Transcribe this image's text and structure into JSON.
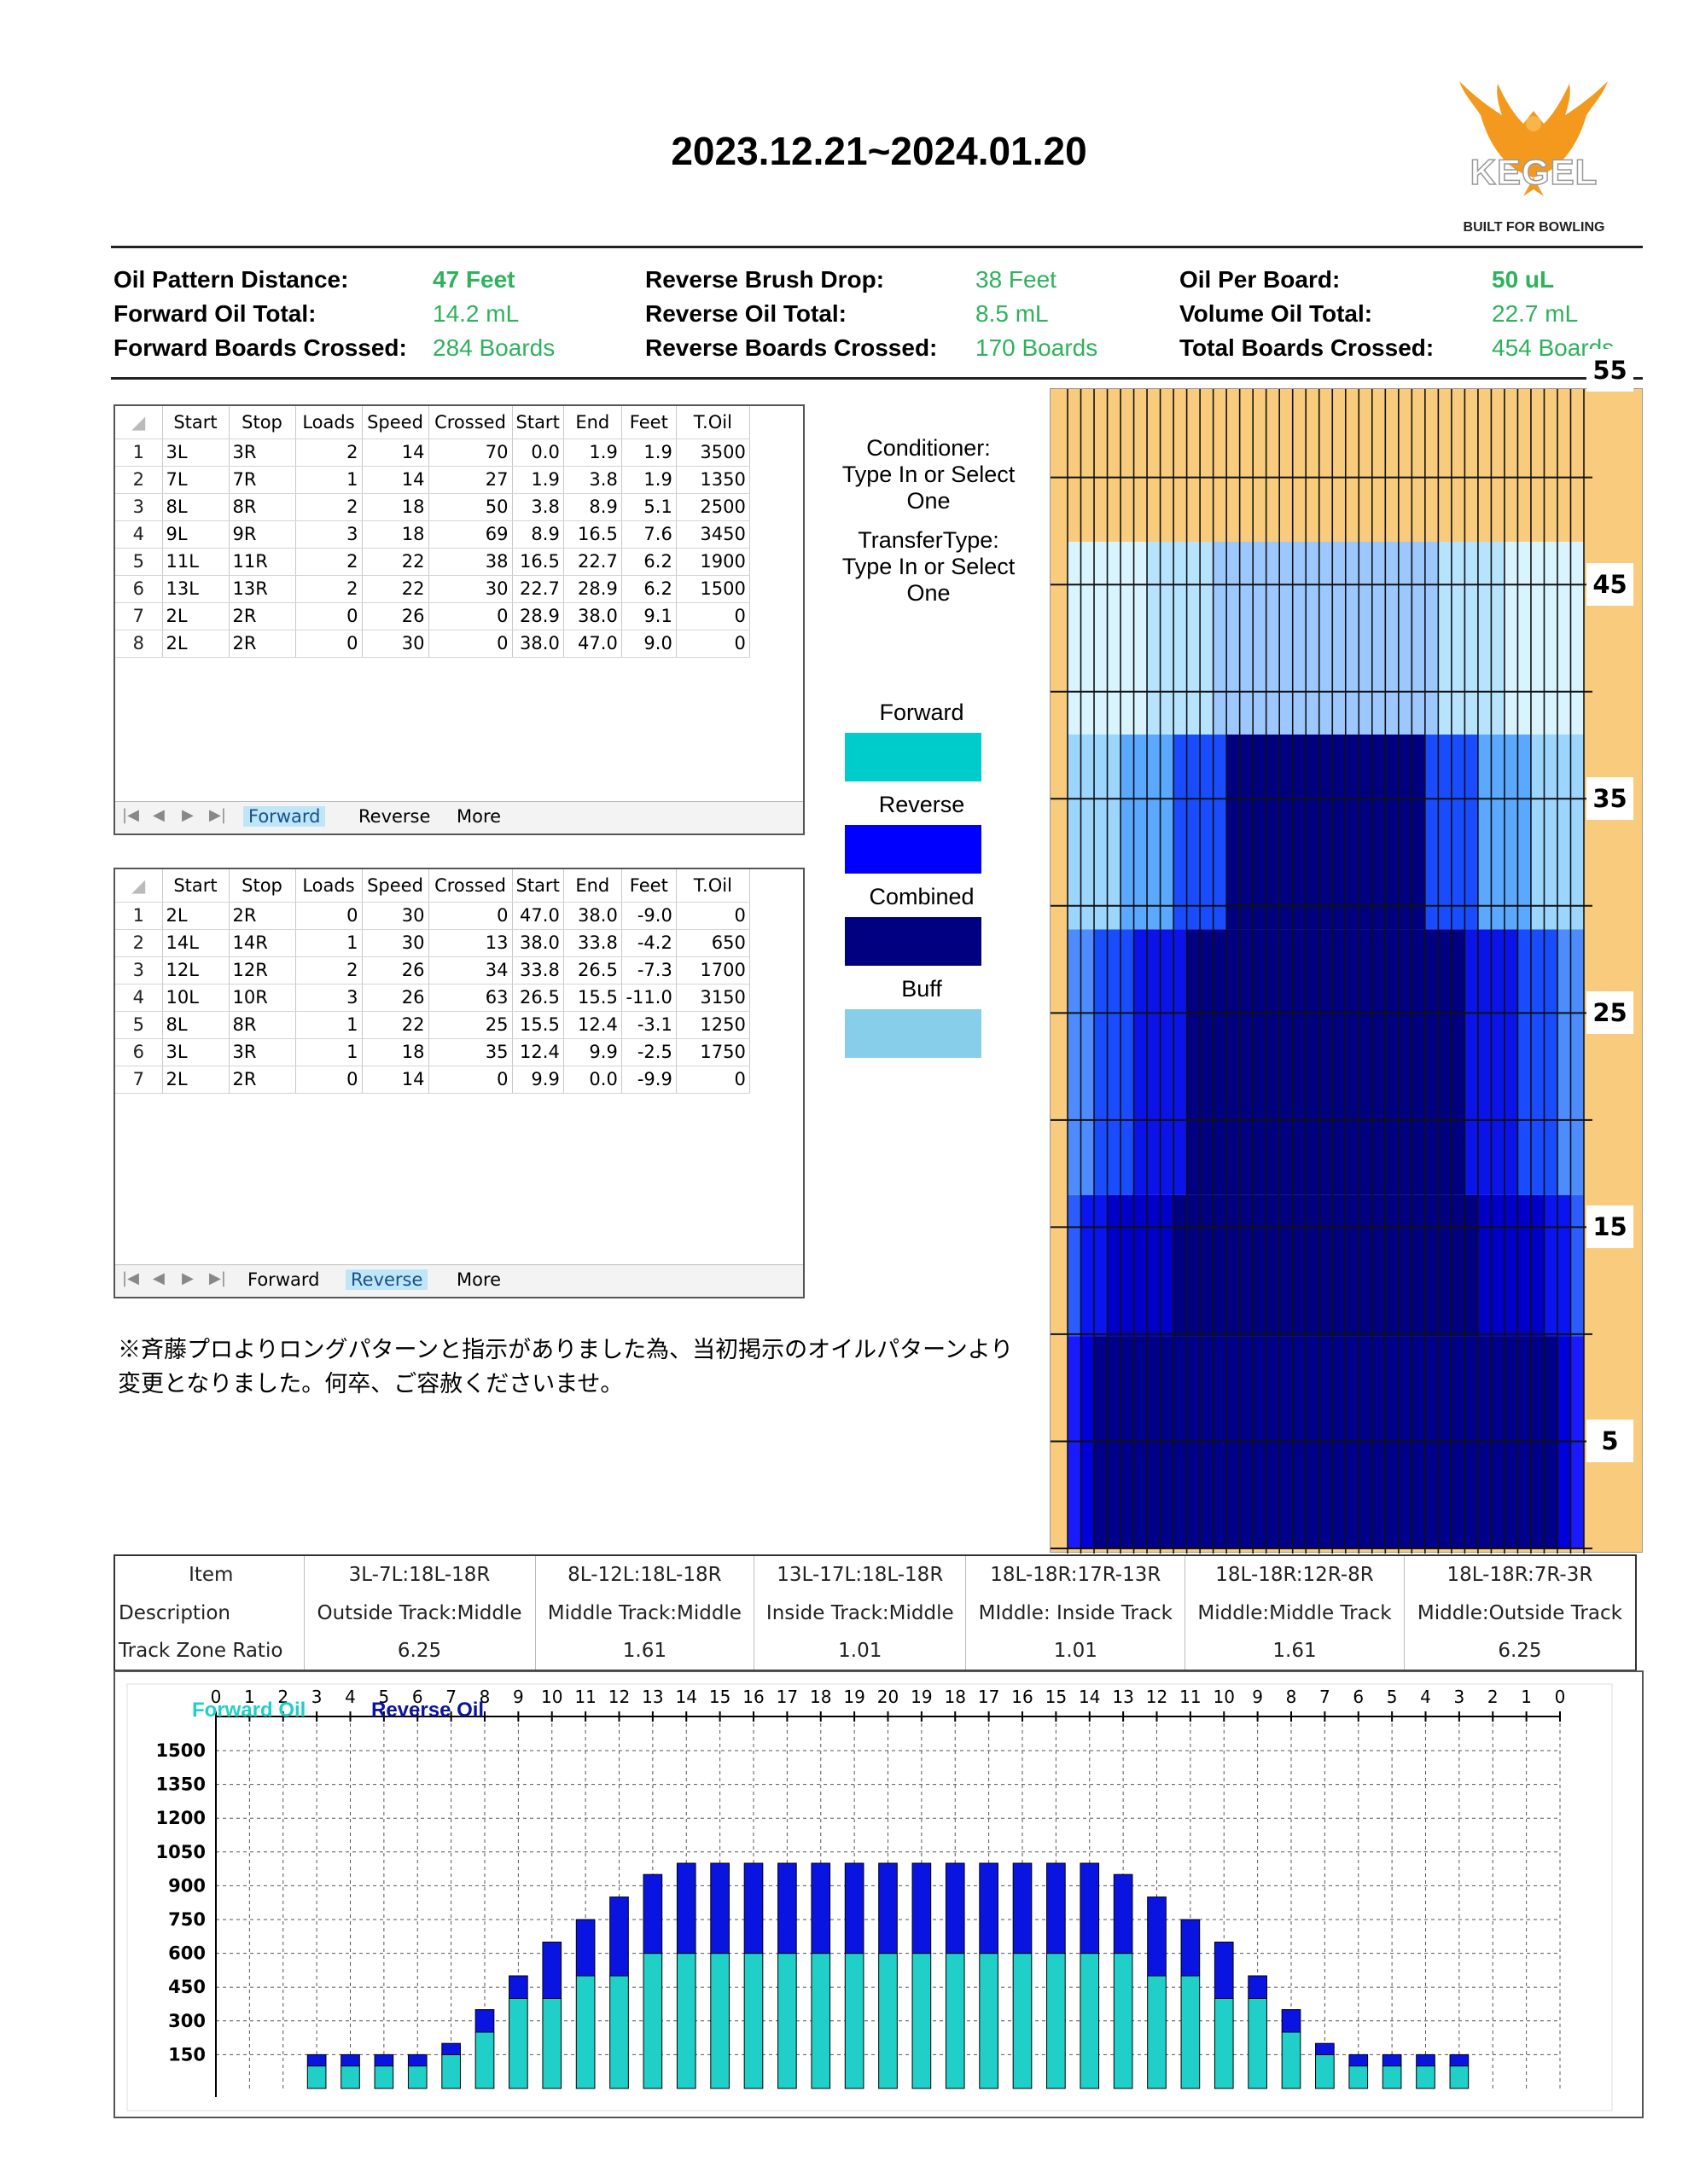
{
  "title": "2023.12.21~2024.01.20",
  "logo": {
    "brand": "KEGEL",
    "tagline": "BUILT FOR BOWLING"
  },
  "summary": {
    "oil_pattern_distance_label": "Oil Pattern Distance:",
    "oil_pattern_distance": "47 Feet",
    "forward_oil_total_label": "Forward Oil Total:",
    "forward_oil_total": "14.2 mL",
    "forward_boards_label": "Forward Boards Crossed:",
    "forward_boards": "284 Boards",
    "reverse_brush_drop_label": "Reverse Brush Drop:",
    "reverse_brush_drop": "38 Feet",
    "reverse_oil_total_label": "Reverse Oil Total:",
    "reverse_oil_total": "8.5 mL",
    "reverse_boards_label": "Reverse Boards Crossed:",
    "reverse_boards": "170 Boards",
    "oil_per_board_label": "Oil Per Board:",
    "oil_per_board": "50 uL",
    "volume_oil_total_label": "Volume Oil Total:",
    "volume_oil_total": "22.7 mL",
    "total_boards_label": "Total Boards Crossed:",
    "total_boards": "454 Boards"
  },
  "columns": [
    "Start",
    "Stop",
    "Loads",
    "Speed",
    "Crossed",
    "Start",
    "End",
    "Feet",
    "T.Oil"
  ],
  "forward_rows": [
    [
      "1",
      "3L",
      "3R",
      "2",
      "14",
      "70",
      "0.0",
      "1.9",
      "1.9",
      "3500"
    ],
    [
      "2",
      "7L",
      "7R",
      "1",
      "14",
      "27",
      "1.9",
      "3.8",
      "1.9",
      "1350"
    ],
    [
      "3",
      "8L",
      "8R",
      "2",
      "18",
      "50",
      "3.8",
      "8.9",
      "5.1",
      "2500"
    ],
    [
      "4",
      "9L",
      "9R",
      "3",
      "18",
      "69",
      "8.9",
      "16.5",
      "7.6",
      "3450"
    ],
    [
      "5",
      "11L",
      "11R",
      "2",
      "22",
      "38",
      "16.5",
      "22.7",
      "6.2",
      "1900"
    ],
    [
      "6",
      "13L",
      "13R",
      "2",
      "22",
      "30",
      "22.7",
      "28.9",
      "6.2",
      "1500"
    ],
    [
      "7",
      "2L",
      "2R",
      "0",
      "26",
      "0",
      "28.9",
      "38.0",
      "9.1",
      "0"
    ],
    [
      "8",
      "2L",
      "2R",
      "0",
      "30",
      "0",
      "38.0",
      "47.0",
      "9.0",
      "0"
    ]
  ],
  "reverse_rows": [
    [
      "1",
      "2L",
      "2R",
      "0",
      "30",
      "0",
      "47.0",
      "38.0",
      "-9.0",
      "0"
    ],
    [
      "2",
      "14L",
      "14R",
      "1",
      "30",
      "13",
      "38.0",
      "33.8",
      "-4.2",
      "650"
    ],
    [
      "3",
      "12L",
      "12R",
      "2",
      "26",
      "34",
      "33.8",
      "26.5",
      "-7.3",
      "1700"
    ],
    [
      "4",
      "10L",
      "10R",
      "3",
      "26",
      "63",
      "26.5",
      "15.5",
      "-11.0",
      "3150"
    ],
    [
      "5",
      "8L",
      "8R",
      "1",
      "22",
      "25",
      "15.5",
      "12.4",
      "-3.1",
      "1250"
    ],
    [
      "6",
      "3L",
      "3R",
      "1",
      "18",
      "35",
      "12.4",
      "9.9",
      "-2.5",
      "1750"
    ],
    [
      "7",
      "2L",
      "2R",
      "0",
      "14",
      "0",
      "9.9",
      "0.0",
      "-9.9",
      "0"
    ]
  ],
  "tabs": {
    "forward": "Forward",
    "reverse": "Reverse",
    "more": "More"
  },
  "conditioner": {
    "line1": "Conditioner:",
    "line2": "Type In or Select",
    "line3": "One"
  },
  "transfer": {
    "line1": "TransferType:",
    "line2": "Type In or Select",
    "line3": "One"
  },
  "legend": [
    {
      "label": "Forward",
      "color": "#00cccc"
    },
    {
      "label": "Reverse",
      "color": "#0000ff"
    },
    {
      "label": "Combined",
      "color": "#000080"
    },
    {
      "label": "Buff",
      "color": "#87ceeb"
    }
  ],
  "lane_markers": [
    "55",
    "45",
    "35",
    "25",
    "15",
    "5"
  ],
  "note": "※斉藤プロよりロングパターンと指示がありました為、当初掲示のオイルパターンより変更となりました。何卒、ご容赦くださいませ。",
  "zones": {
    "row_labels": [
      "Item",
      "Description",
      "Track Zone Ratio"
    ],
    "items": [
      "3L-7L:18L-18R",
      "8L-12L:18L-18R",
      "13L-17L:18L-18R",
      "18L-18R:17R-13R",
      "18L-18R:12R-8R",
      "18L-18R:7R-3R"
    ],
    "descriptions": [
      "Outside Track:Middle",
      "Middle Track:Middle",
      "Inside Track:Middle",
      "MIddle: Inside Track",
      "Middle:Middle Track",
      "Middle:Outside Track"
    ],
    "ratios": [
      "6.25",
      "1.61",
      "1.01",
      "1.01",
      "1.61",
      "6.25"
    ]
  },
  "chart_data": {
    "type": "bar",
    "stacked": true,
    "legend_position": "top-left",
    "grid": true,
    "categories": [
      "0",
      "1",
      "2",
      "3",
      "4",
      "5",
      "6",
      "7",
      "8",
      "9",
      "10",
      "11",
      "12",
      "13",
      "14",
      "15",
      "16",
      "17",
      "18",
      "19",
      "20",
      "19",
      "18",
      "17",
      "16",
      "15",
      "14",
      "13",
      "12",
      "11",
      "10",
      "9",
      "8",
      "7",
      "6",
      "5",
      "4",
      "3",
      "2",
      "1",
      "0"
    ],
    "series": [
      {
        "name": "Forward Oil",
        "color": "#1fcfc8",
        "values": [
          0,
          0,
          0,
          100,
          100,
          100,
          100,
          150,
          250,
          400,
          400,
          500,
          500,
          600,
          600,
          600,
          600,
          600,
          600,
          600,
          600,
          600,
          600,
          600,
          600,
          600,
          600,
          600,
          500,
          500,
          400,
          400,
          250,
          150,
          100,
          100,
          100,
          100,
          0,
          0,
          0
        ]
      },
      {
        "name": "Reverse Oil",
        "color": "#0a14e0",
        "values": [
          0,
          0,
          0,
          50,
          50,
          50,
          50,
          50,
          100,
          100,
          250,
          250,
          350,
          350,
          400,
          400,
          400,
          400,
          400,
          400,
          400,
          400,
          400,
          400,
          400,
          400,
          400,
          350,
          350,
          250,
          250,
          100,
          100,
          50,
          50,
          50,
          50,
          50,
          0,
          0,
          0
        ]
      }
    ],
    "yticks": [
      150,
      300,
      450,
      600,
      750,
      900,
      1050,
      1200,
      1350,
      1500
    ],
    "ylim": [
      0,
      1500
    ]
  }
}
